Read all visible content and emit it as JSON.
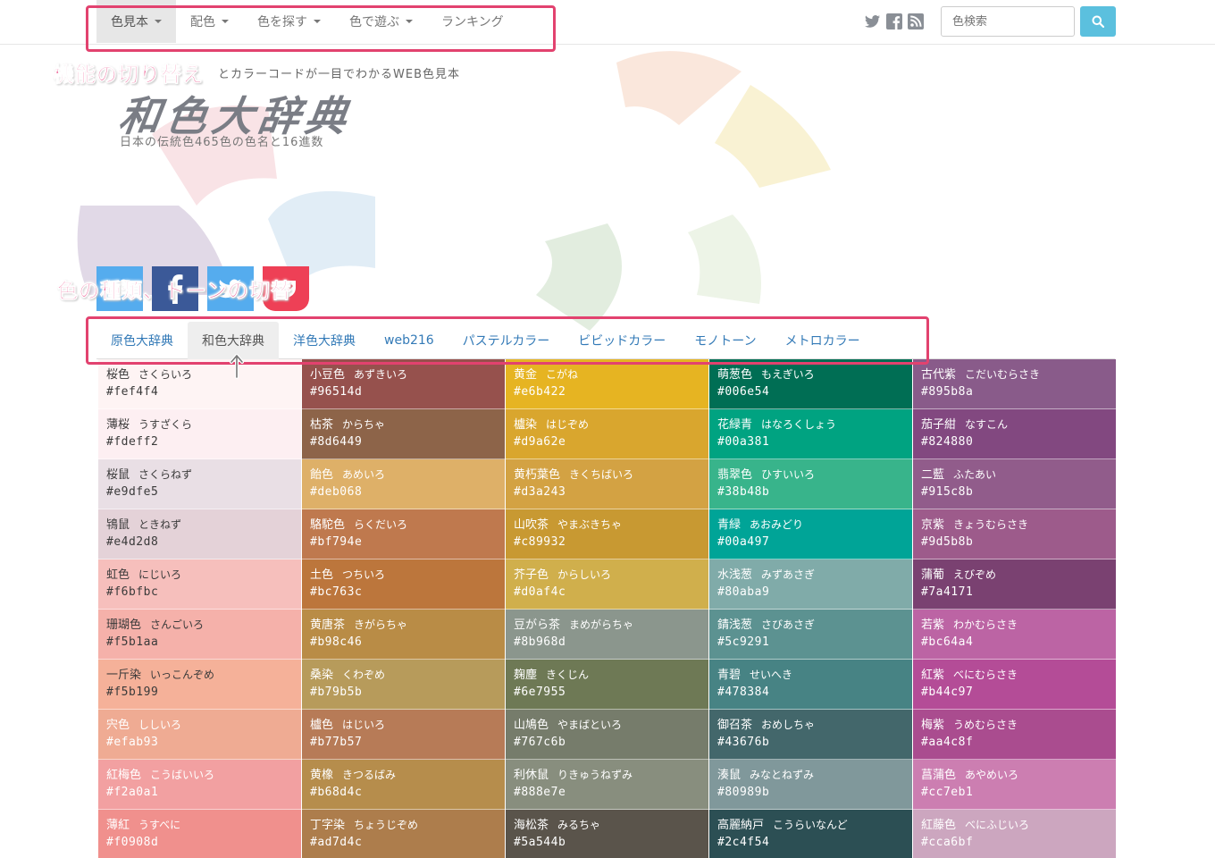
{
  "nav": {
    "items": [
      {
        "label": "色見本",
        "caret": true,
        "active": true
      },
      {
        "label": "配色",
        "caret": true
      },
      {
        "label": "色を探す",
        "caret": true
      },
      {
        "label": "色で遊ぶ",
        "caret": true
      },
      {
        "label": "ランキング",
        "caret": false
      }
    ]
  },
  "social": [
    "twitter-icon",
    "facebook-icon",
    "rss-icon"
  ],
  "search": {
    "placeholder": "色検索",
    "button_icon": "search-icon",
    "button_color": "#5bc0de"
  },
  "header": {
    "tagline": "とカラーコードが一目でわかるWEB色見本",
    "logo": "和色大辞典",
    "subtitle": "日本の伝統色465色の色名と16進数"
  },
  "share_buttons": [
    {
      "icon": "twitter-icon",
      "color": "#55acee"
    },
    {
      "icon": "facebook-icon",
      "color": "#3b5998"
    },
    {
      "icon": "twitter-icon",
      "color": "#55acee"
    },
    {
      "icon": "pocket-icon",
      "color": "#ee4056"
    }
  ],
  "annotations": {
    "nav_label": "機能の切り替え",
    "tabs_label": "色の種類、トーンの切替",
    "accent": "#e2426f"
  },
  "tabs": [
    {
      "label": "原色大辞典"
    },
    {
      "label": "和色大辞典",
      "active": true
    },
    {
      "label": "洋色大辞典"
    },
    {
      "label": "web216"
    },
    {
      "label": "パステルカラー"
    },
    {
      "label": "ビビッドカラー"
    },
    {
      "label": "モノトーン"
    },
    {
      "label": "メトロカラー"
    }
  ],
  "colors": [
    [
      {
        "name": "桜色",
        "kana": "さくらいろ",
        "hex": "#fef4f4"
      },
      {
        "name": "薄桜",
        "kana": "うすざくら",
        "hex": "#fdeff2"
      },
      {
        "name": "桜鼠",
        "kana": "さくらねず",
        "hex": "#e9dfe5"
      },
      {
        "name": "鴇鼠",
        "kana": "ときねず",
        "hex": "#e4d2d8"
      },
      {
        "name": "虹色",
        "kana": "にじいろ",
        "hex": "#f6bfbc"
      },
      {
        "name": "珊瑚色",
        "kana": "さんごいろ",
        "hex": "#f5b1aa"
      },
      {
        "name": "一斤染",
        "kana": "いっこんぞめ",
        "hex": "#f5b199"
      },
      {
        "name": "宍色",
        "kana": "ししいろ",
        "hex": "#efab93"
      },
      {
        "name": "紅梅色",
        "kana": "こうばいいろ",
        "hex": "#f2a0a1"
      },
      {
        "name": "薄紅",
        "kana": "うすべに",
        "hex": "#f0908d"
      }
    ],
    [
      {
        "name": "小豆色",
        "kana": "あずきいろ",
        "hex": "#96514d"
      },
      {
        "name": "枯茶",
        "kana": "からちゃ",
        "hex": "#8d6449"
      },
      {
        "name": "飴色",
        "kana": "あめいろ",
        "hex": "#deb068"
      },
      {
        "name": "駱駝色",
        "kana": "らくだいろ",
        "hex": "#bf794e"
      },
      {
        "name": "土色",
        "kana": "つちいろ",
        "hex": "#bc763c"
      },
      {
        "name": "黄唐茶",
        "kana": "きがらちゃ",
        "hex": "#b98c46"
      },
      {
        "name": "桑染",
        "kana": "くわぞめ",
        "hex": "#b79b5b"
      },
      {
        "name": "櫨色",
        "kana": "はじいろ",
        "hex": "#b77b57"
      },
      {
        "name": "黄橡",
        "kana": "きつるばみ",
        "hex": "#b68d4c"
      },
      {
        "name": "丁字染",
        "kana": "ちょうじぞめ",
        "hex": "#ad7d4c"
      }
    ],
    [
      {
        "name": "黄金",
        "kana": "こがね",
        "hex": "#e6b422"
      },
      {
        "name": "櫨染",
        "kana": "はじぞめ",
        "hex": "#d9a62e"
      },
      {
        "name": "黄朽葉色",
        "kana": "きくちばいろ",
        "hex": "#d3a243"
      },
      {
        "name": "山吹茶",
        "kana": "やまぶきちゃ",
        "hex": "#c89932"
      },
      {
        "name": "芥子色",
        "kana": "からしいろ",
        "hex": "#d0af4c"
      },
      {
        "name": "豆がら茶",
        "kana": "まめがらちゃ",
        "hex": "#8b968d"
      },
      {
        "name": "麹塵",
        "kana": "きくじん",
        "hex": "#6e7955"
      },
      {
        "name": "山鳩色",
        "kana": "やまばといろ",
        "hex": "#767c6b"
      },
      {
        "name": "利休鼠",
        "kana": "りきゅうねずみ",
        "hex": "#888e7e"
      },
      {
        "name": "海松茶",
        "kana": "みるちゃ",
        "hex": "#5a544b"
      }
    ],
    [
      {
        "name": "萌葱色",
        "kana": "もえぎいろ",
        "hex": "#006e54"
      },
      {
        "name": "花緑青",
        "kana": "はなろくしょう",
        "hex": "#00a381"
      },
      {
        "name": "翡翠色",
        "kana": "ひすいいろ",
        "hex": "#38b48b"
      },
      {
        "name": "青緑",
        "kana": "あおみどり",
        "hex": "#00a497"
      },
      {
        "name": "水浅葱",
        "kana": "みずあさぎ",
        "hex": "#80aba9"
      },
      {
        "name": "錆浅葱",
        "kana": "さびあさぎ",
        "hex": "#5c9291"
      },
      {
        "name": "青碧",
        "kana": "せいへき",
        "hex": "#478384"
      },
      {
        "name": "御召茶",
        "kana": "おめしちゃ",
        "hex": "#43676b"
      },
      {
        "name": "湊鼠",
        "kana": "みなとねずみ",
        "hex": "#80989b"
      },
      {
        "name": "高麗納戸",
        "kana": "こうらいなんど",
        "hex": "#2c4f54"
      }
    ],
    [
      {
        "name": "古代紫",
        "kana": "こだいむらさき",
        "hex": "#895b8a"
      },
      {
        "name": "茄子紺",
        "kana": "なすこん",
        "hex": "#824880"
      },
      {
        "name": "二藍",
        "kana": "ふたあい",
        "hex": "#915c8b"
      },
      {
        "name": "京紫",
        "kana": "きょうむらさき",
        "hex": "#9d5b8b"
      },
      {
        "name": "蒲葡",
        "kana": "えびぞめ",
        "hex": "#7a4171"
      },
      {
        "name": "若紫",
        "kana": "わかむらさき",
        "hex": "#bc64a4"
      },
      {
        "name": "紅紫",
        "kana": "べにむらさき",
        "hex": "#b44c97"
      },
      {
        "name": "梅紫",
        "kana": "うめむらさき",
        "hex": "#aa4c8f"
      },
      {
        "name": "菖蒲色",
        "kana": "あやめいろ",
        "hex": "#cc7eb1"
      },
      {
        "name": "紅藤色",
        "kana": "べにふじいろ",
        "hex": "#cca6bf"
      }
    ]
  ]
}
